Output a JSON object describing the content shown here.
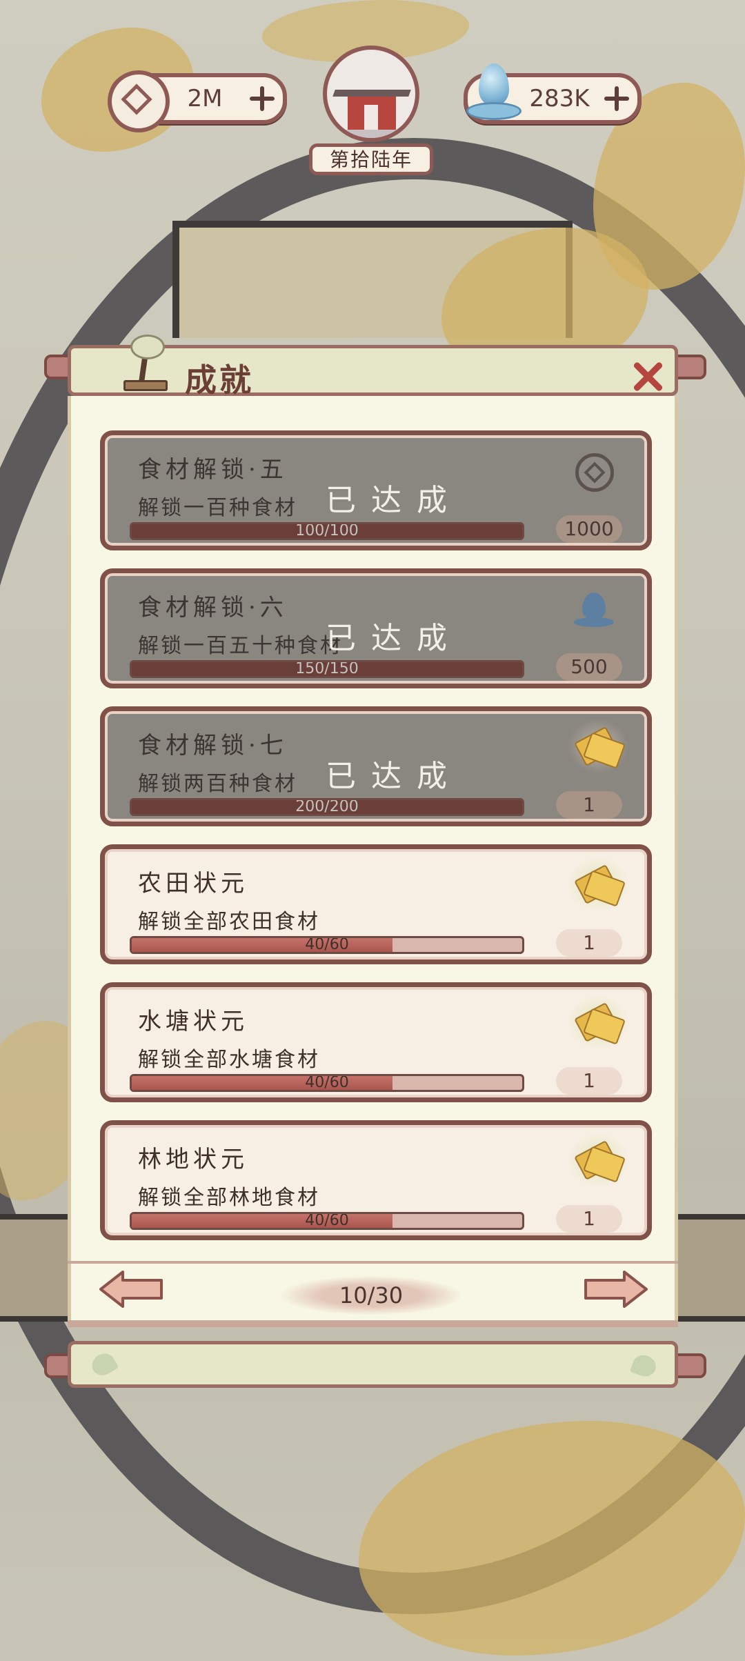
{
  "hud": {
    "coins": "2M",
    "water": "283K",
    "year_label": "第拾陆年"
  },
  "panel": {
    "title": "成就"
  },
  "achievements": [
    {
      "title": "食材解锁·五",
      "desc": "解锁一百种食材",
      "progress": "100/100",
      "fraction": 1.0,
      "completed": true,
      "stamp": "已达成",
      "reward_icon": "coin-icon",
      "reward_amount": "1000"
    },
    {
      "title": "食材解锁·六",
      "desc": "解锁一百五十种食材",
      "progress": "150/150",
      "fraction": 1.0,
      "completed": true,
      "stamp": "已达成",
      "reward_icon": "water-drop-icon",
      "reward_amount": "500"
    },
    {
      "title": "食材解锁·七",
      "desc": "解锁两百种食材",
      "progress": "200/200",
      "fraction": 1.0,
      "completed": true,
      "stamp": "已达成",
      "reward_icon": "ticket-icon",
      "reward_amount": "1"
    },
    {
      "title": "农田状元",
      "desc": "解锁全部农田食材",
      "progress": "40/60",
      "fraction": 0.667,
      "completed": false,
      "reward_icon": "ticket-icon",
      "reward_amount": "1"
    },
    {
      "title": "水塘状元",
      "desc": "解锁全部水塘食材",
      "progress": "40/60",
      "fraction": 0.667,
      "completed": false,
      "reward_icon": "ticket-icon",
      "reward_amount": "1"
    },
    {
      "title": "林地状元",
      "desc": "解锁全部林地食材",
      "progress": "40/60",
      "fraction": 0.667,
      "completed": false,
      "reward_icon": "ticket-icon",
      "reward_amount": "1"
    }
  ],
  "pagination": {
    "page": "10/30"
  }
}
